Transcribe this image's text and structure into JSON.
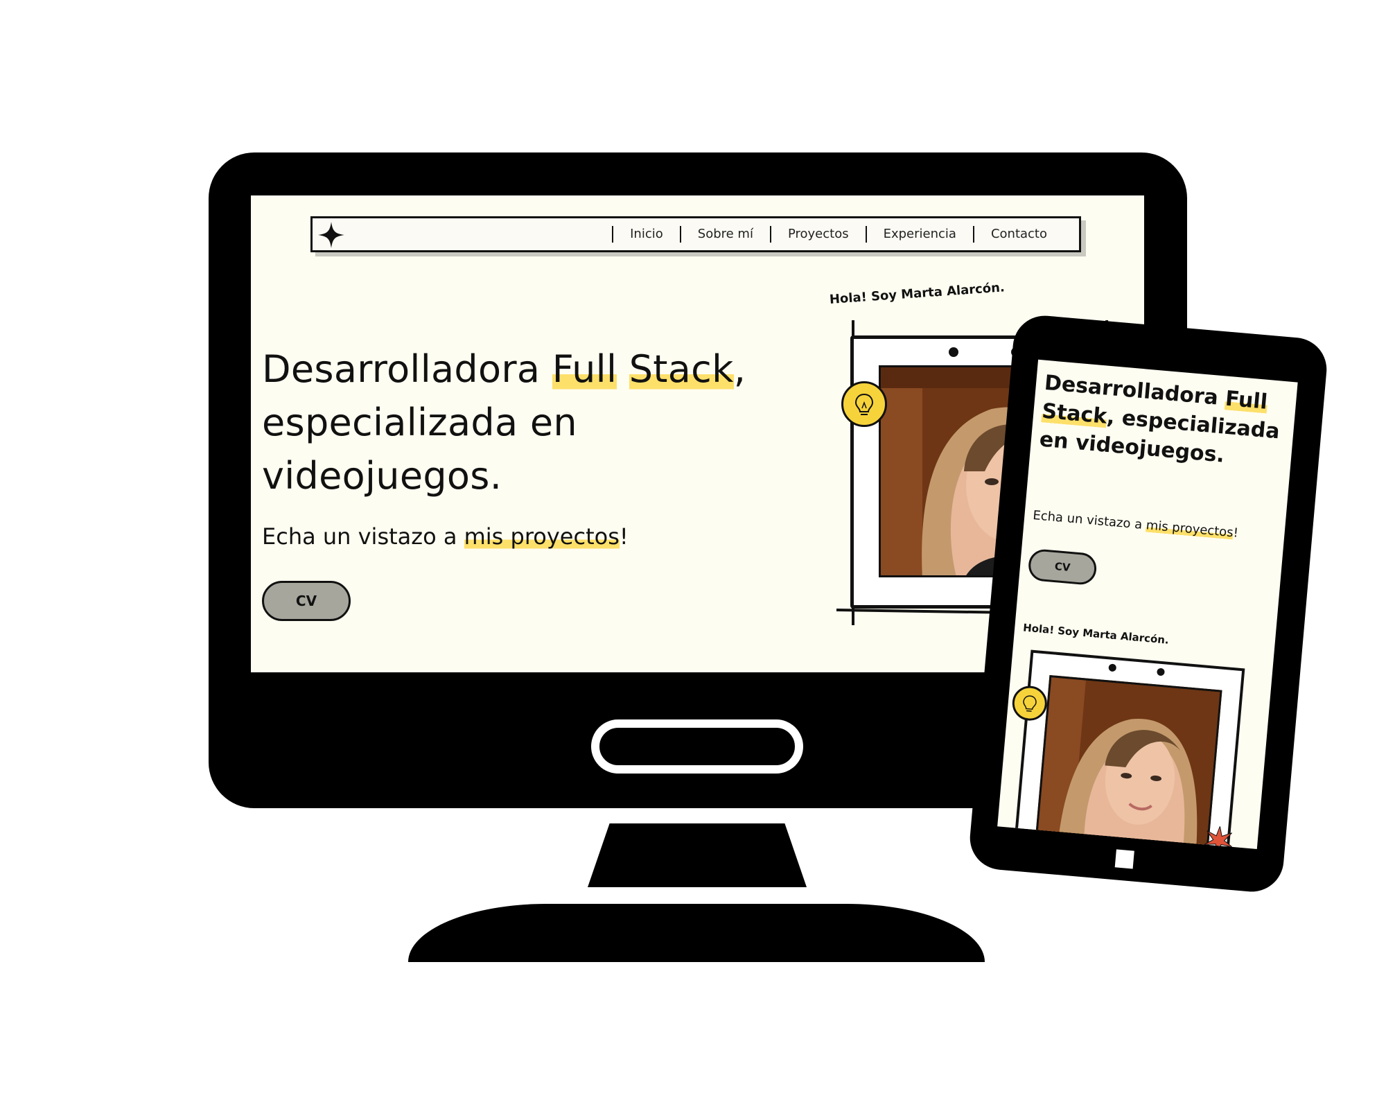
{
  "desktop": {
    "nav": {
      "links": [
        "Inicio",
        "Sobre mí",
        "Proyectos",
        "Experiencia",
        "Contacto"
      ]
    },
    "hero": {
      "title_before": "Desarrolladora ",
      "title_highlight1": "Full",
      "title_highlight2": "Stack",
      "title_after": ", especializada en videojuegos.",
      "sub_before": "Echa un vistazo a ",
      "sub_highlight": "mis proyectos",
      "sub_after": "!",
      "cv_label": "CV"
    },
    "profile": {
      "greeting": "Hola! Soy Marta Alarcón."
    }
  },
  "mobile": {
    "hero": {
      "title_before": "Desarrolladora ",
      "title_highlight1": "Full",
      "title_highlight2": "Stack",
      "title_after": ", especializada en videojuegos.",
      "sub_before": "Echa un vistazo a ",
      "sub_highlight": "mis proyectos",
      "sub_after": "!",
      "cv_label": "CV"
    },
    "profile": {
      "greeting": "Hola! Soy Marta Alarcón."
    }
  },
  "colors": {
    "background": "#fefdf1",
    "highlight": "#fde06a",
    "button": "#a6a69d",
    "bulb": "#f6d33a"
  },
  "icons": [
    "sparkle-logo-icon",
    "lightbulb-icon",
    "burst-icon",
    "home-button-icon"
  ]
}
